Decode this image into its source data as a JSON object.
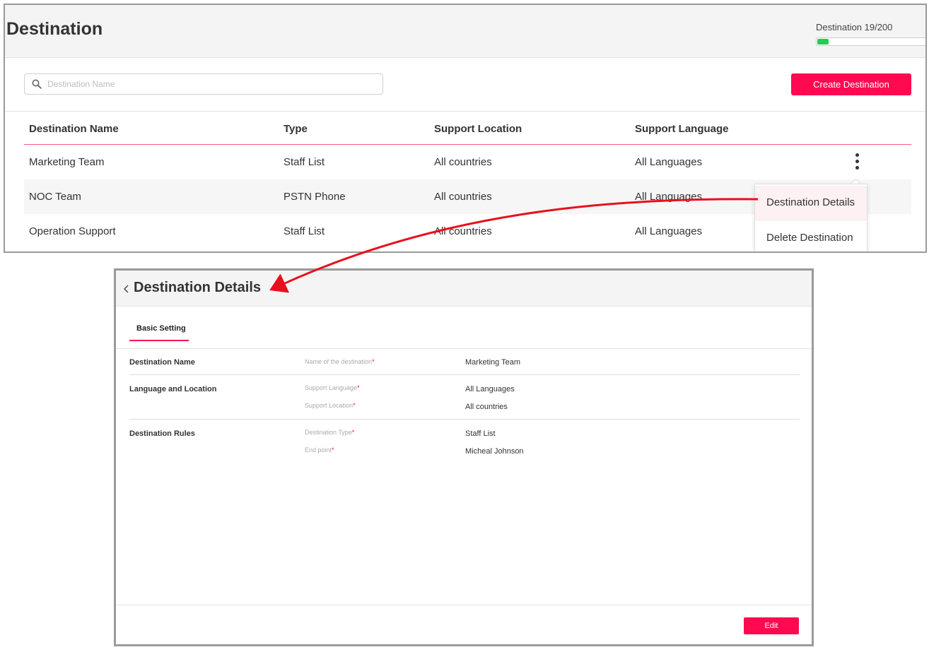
{
  "destination_list": {
    "title": "Destination",
    "quota": {
      "label": "Destination 19/200",
      "used": 19,
      "total": 200
    },
    "search": {
      "placeholder": "Destination Name",
      "value": ""
    },
    "create_button": "Create Destination",
    "columns": [
      "Destination Name",
      "Type",
      "Support Location",
      "Support Language"
    ],
    "rows": [
      {
        "name": "Marketing Team",
        "type": "Staff List",
        "location": "All countries",
        "language": "All Languages"
      },
      {
        "name": "NOC Team",
        "type": "PSTN Phone",
        "location": "All countries",
        "language": "All Languages"
      },
      {
        "name": "Operation Support",
        "type": "Staff List",
        "location": "All countries",
        "language": "All Languages"
      }
    ],
    "row_menu": {
      "icon": "kebab-menu-icon",
      "items": [
        "Destination Details",
        "Delete Destination"
      ]
    }
  },
  "destination_details": {
    "back_icon": "chevron-left-icon",
    "title": "Destination Details",
    "tabs": [
      "Basic Setting"
    ],
    "sections": [
      {
        "title": "Destination Name",
        "fields": [
          {
            "label": "Name of the destination",
            "required": "*",
            "value": "Marketing Team"
          }
        ]
      },
      {
        "title": "Language and Location",
        "fields": [
          {
            "label": "Support Language",
            "required": "*",
            "value": "All Languages"
          },
          {
            "label": "Support Location",
            "required": "*",
            "value": "All countries"
          }
        ]
      },
      {
        "title": "Destination Rules",
        "fields": [
          {
            "label": "Destination Type",
            "required": "*",
            "value": "Staff List"
          },
          {
            "label": "End point",
            "required": "*",
            "value": "Micheal Johnson"
          }
        ]
      }
    ],
    "edit_button": "Edit"
  },
  "colors": {
    "accent": "#ff0a50",
    "progress": "#22cc55",
    "arrow": "#e8101e"
  }
}
